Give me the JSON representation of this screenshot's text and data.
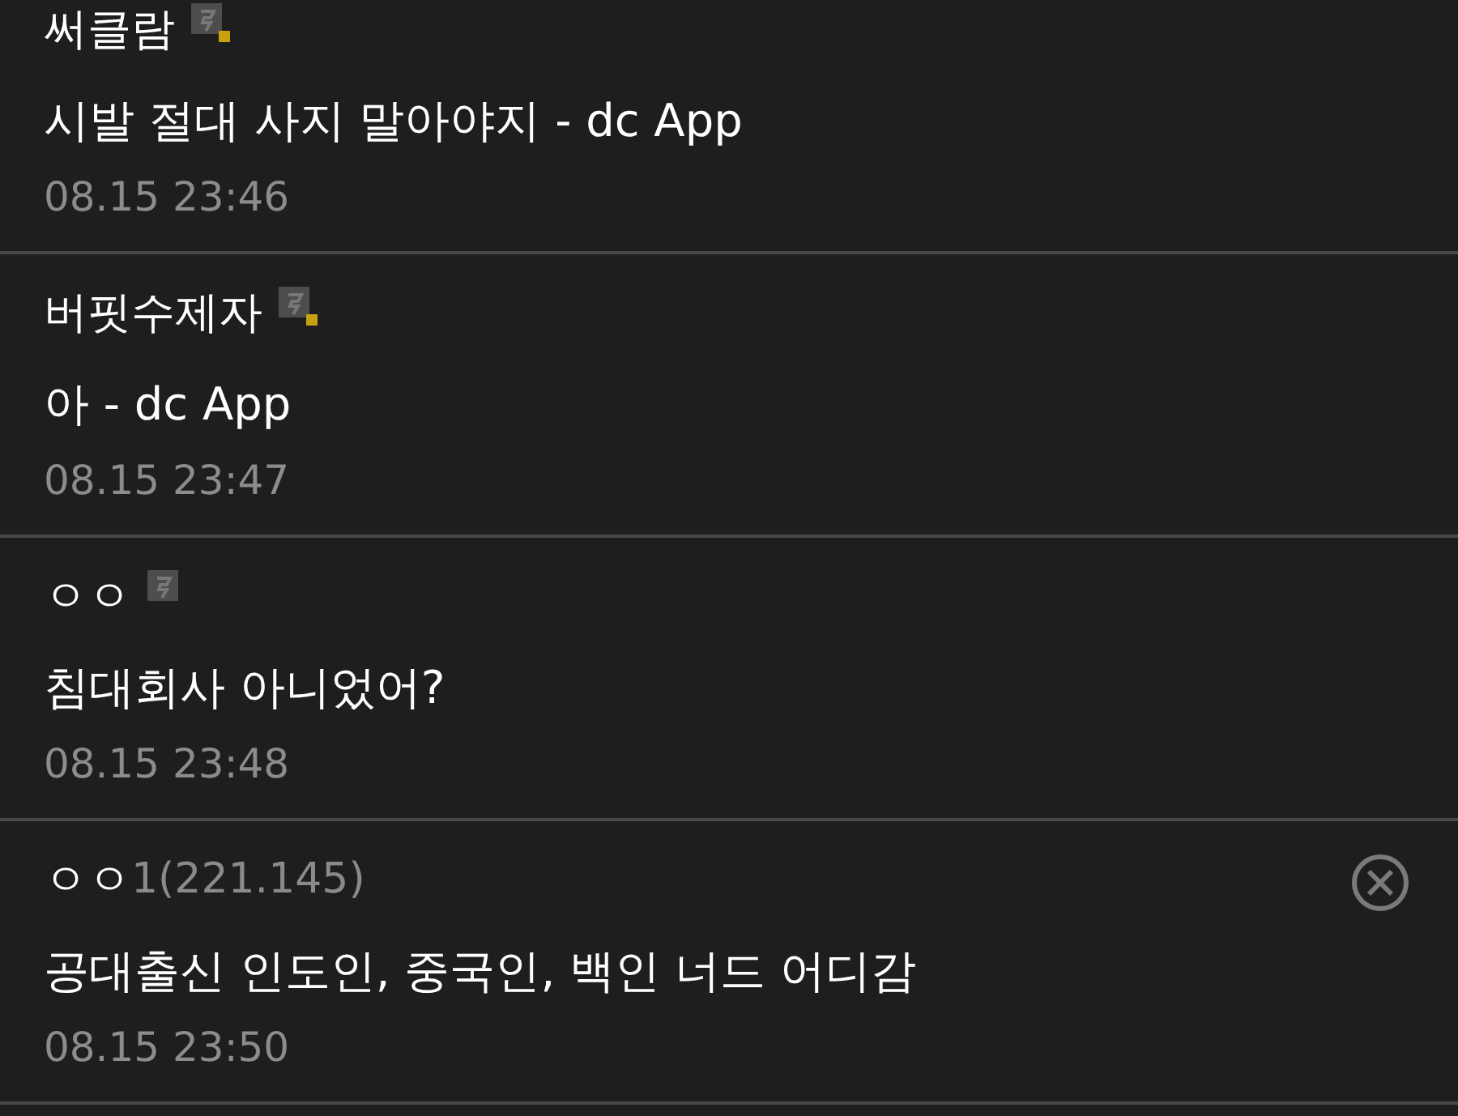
{
  "comments": [
    {
      "kind": "fixed",
      "name": "써클람",
      "text": "시발 절대 사지 말아야지 - dc App",
      "time": "08.15 23:46"
    },
    {
      "kind": "fixed",
      "name": "버핏수제자",
      "text": "아 - dc App",
      "time": "08.15 23:47"
    },
    {
      "kind": "semi",
      "name": "ㅇㅇ",
      "text": "침대회사 아니었어?",
      "time": "08.15 23:48"
    },
    {
      "kind": "guest",
      "name": "ㅇㅇ",
      "ip": "1(221.145)",
      "deletable": true,
      "text": "공대출신 인도인, 중국인, 백인 너드 어디감",
      "time": "08.15 23:50"
    }
  ]
}
